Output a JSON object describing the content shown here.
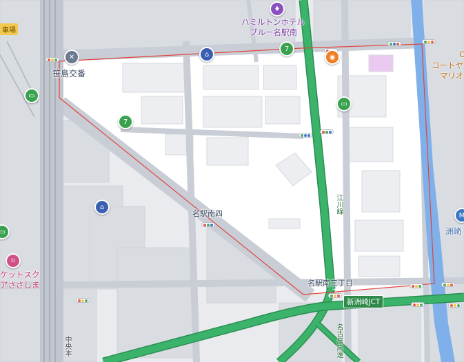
{
  "colors": {
    "background": "#e9ebee",
    "block": "#d9dce1",
    "highlight_area": "#ffffff",
    "boundary": "#e0443c",
    "expressway": "#3bb36a",
    "expressway_edge": "#2a8e50",
    "major_road": "#c9ced6",
    "rail": "#a8aeb8",
    "river": "#7fb0ea",
    "signal": "#ffffff"
  },
  "labels": {
    "police_box": "笹島交番",
    "hotel_line1": "ハミルトンホテル",
    "hotel_line2": "ブルー名駅南",
    "intersection_4": "名駅南四",
    "intersection_3": "名駅南三丁目",
    "jct": "新洲崎JCT",
    "road_egawa": "江川線",
    "road_expressway": "名古屋高速",
    "road_chuo": "中央本",
    "parking": "車場",
    "shop_line1": "ケットスク",
    "shop_line2": "アささしま",
    "right_line1": "コートヤ",
    "right_line2": "マリオ",
    "right_c": "C",
    "station_right": "洲崎"
  },
  "icons": {
    "police": "police-icon",
    "bank_top": "bank-icon",
    "bank_left": "bank-icon",
    "convenience_top": "convenience-store-icon",
    "convenience_mid": "convenience-store-icon",
    "hotel": "hotel-icon",
    "restaurant": "restaurant-icon",
    "bus_left": "bus-stop-icon",
    "bus_mid": "bus-stop-icon",
    "shopping": "shopping-bag-icon",
    "station_right": "station-icon",
    "station_left": "station-icon"
  }
}
